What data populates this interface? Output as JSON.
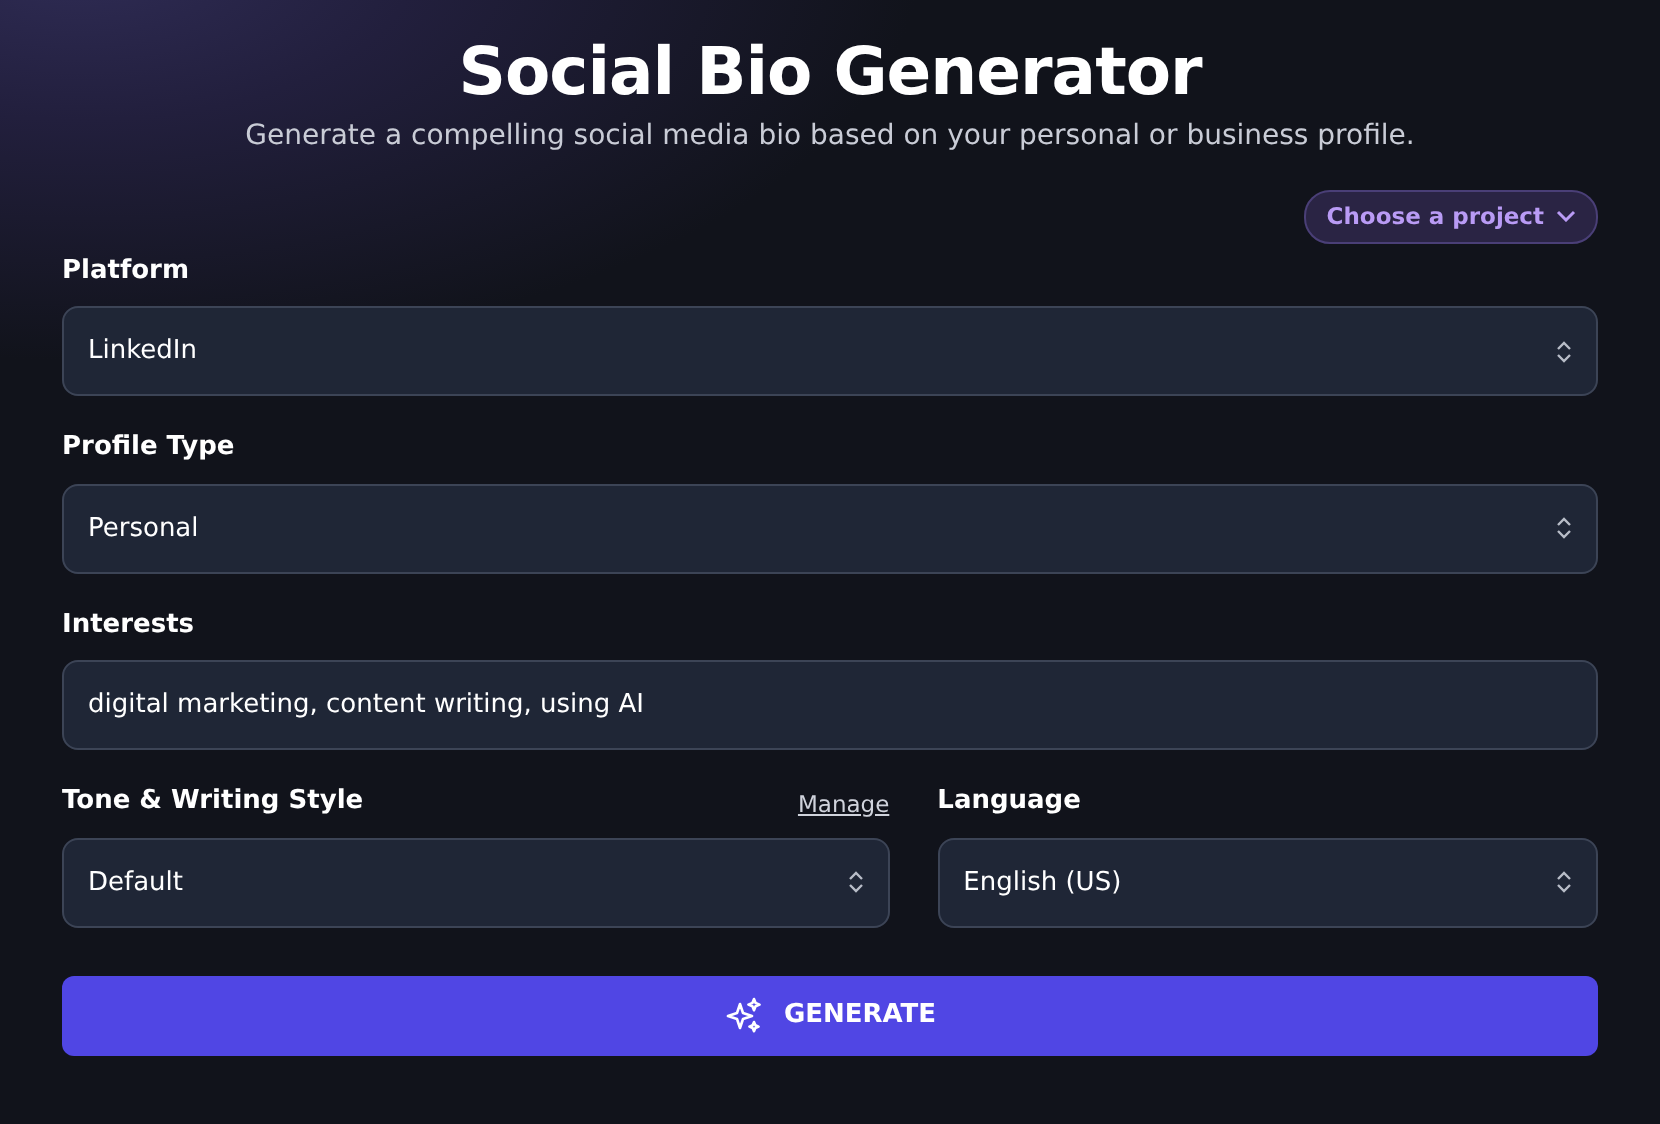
{
  "header": {
    "title": "Social Bio Generator",
    "subtitle": "Generate a compelling social media bio based on your personal or business profile."
  },
  "project_button": {
    "label": "Choose a project"
  },
  "rows": [
    [
      {
        "label": "Platform",
        "kind": "select",
        "value": "LinkedIn"
      }
    ],
    [
      {
        "label": "Profile Type",
        "kind": "select",
        "value": "Personal"
      }
    ],
    [
      {
        "label": "Interests",
        "kind": "text",
        "value": "digital marketing, content writing, using AI"
      }
    ],
    [
      {
        "label": "Tone & Writing Style",
        "kind": "select",
        "value": "Default",
        "action": "Manage"
      },
      {
        "label": "Language",
        "kind": "select",
        "value": "English (US)"
      }
    ]
  ],
  "generate_button": {
    "label": "GENERATE"
  }
}
